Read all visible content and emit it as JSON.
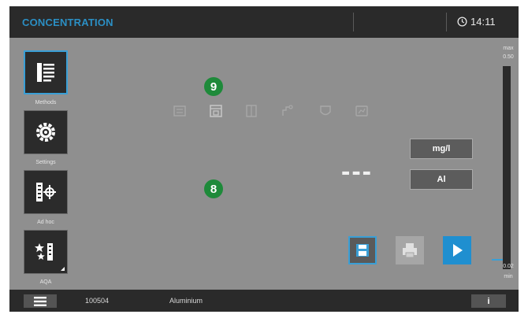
{
  "header": {
    "title": "CONCENTRATION",
    "time": "14:11",
    "clock_icon": "clock-icon"
  },
  "sidebar": {
    "items": [
      {
        "label": "Methods",
        "icon": "methods-list-icon",
        "active": true
      },
      {
        "label": "Settings",
        "icon": "settings-gear-icon",
        "active": false
      },
      {
        "label": "Ad hoc",
        "icon": "ad-hoc-icon",
        "active": false
      },
      {
        "label": "AQA",
        "icon": "aqa-stars-icon",
        "active": false
      }
    ]
  },
  "toolbar": {
    "icons": [
      "tool-1-icon",
      "tool-2-icon",
      "tool-3-icon",
      "tool-4-icon",
      "tool-5-icon",
      "tool-6-icon"
    ]
  },
  "callouts": {
    "top": "9",
    "bottom": "8"
  },
  "result": {
    "value": "---",
    "unit": "mg/l",
    "species": "Al"
  },
  "actions": {
    "save_icon": "save-icon",
    "print_icon": "print-icon",
    "start_icon": "play-icon"
  },
  "range": {
    "max_label": "max",
    "max_value": "0.50",
    "min_value": "0.02",
    "min_label": "min"
  },
  "status": {
    "menu_icon": "hamburger-menu-icon",
    "method_id": "100504",
    "method_name": "Aluminium",
    "info_label": "i"
  },
  "colors": {
    "accent": "#3a9fd6",
    "callout": "#1e8a3a",
    "background": "#8f8f8f",
    "bar": "#2a2a2a"
  }
}
